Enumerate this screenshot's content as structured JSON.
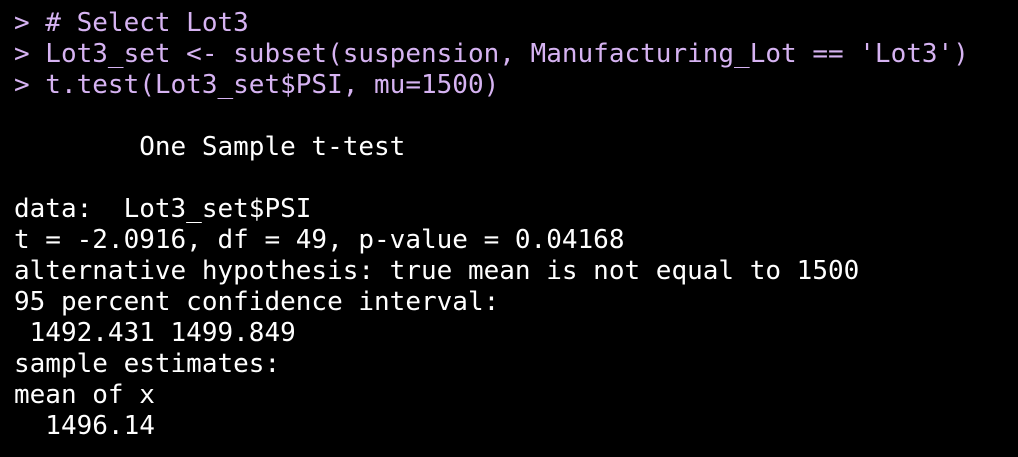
{
  "console": {
    "input_color": "#d6b3f2",
    "output_color": "#ffffff",
    "background": "#000000",
    "input_lines": [
      "> # Select Lot3",
      "> Lot3_set <- subset(suspension, Manufacturing_Lot == 'Lot3')",
      "> t.test(Lot3_set$PSI, mu=1500)"
    ],
    "output": {
      "test_title": "        One Sample t-test",
      "data_line": "data:  Lot3_set$PSI",
      "stats_line": "t = -2.0916, df = 49, p-value = 0.04168",
      "alternative_line": "alternative hypothesis: true mean is not equal to 1500",
      "ci_label": "95 percent confidence interval:",
      "ci_values": " 1492.431 1499.849",
      "estimates_label": "sample estimates:",
      "estimate_name": "mean of x",
      "estimate_value": "  1496.14"
    }
  }
}
